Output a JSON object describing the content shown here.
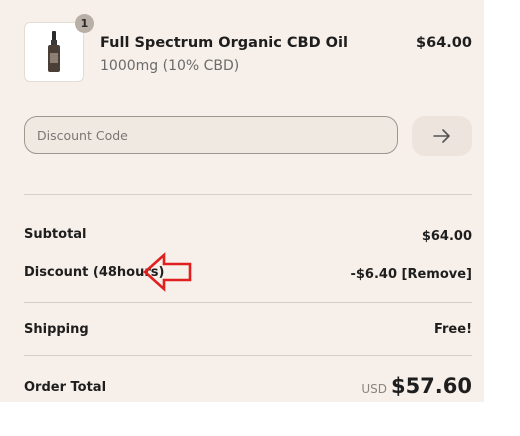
{
  "cart": {
    "item": {
      "quantity": "1",
      "name": "Full Spectrum Organic CBD Oil",
      "variant": "1000mg (10% CBD)",
      "price": "$64.00",
      "image_icon": "cbd-oil-bottle-icon"
    }
  },
  "discount": {
    "placeholder": "Discount Code",
    "value": "",
    "apply_icon": "arrow-right-icon"
  },
  "summary": {
    "subtotal_label": "Subtotal",
    "subtotal_value": "$64.00",
    "discount_label": "Discount (48hours)",
    "discount_value": "-$6.40",
    "remove_label": "[Remove]",
    "shipping_label": "Shipping",
    "shipping_value": "Free!",
    "total_label": "Order Total",
    "total_currency": "USD",
    "total_value": "$57.60"
  },
  "colors": {
    "panel_background": "#f7efe9",
    "annotation_arrow": "#e02020"
  }
}
